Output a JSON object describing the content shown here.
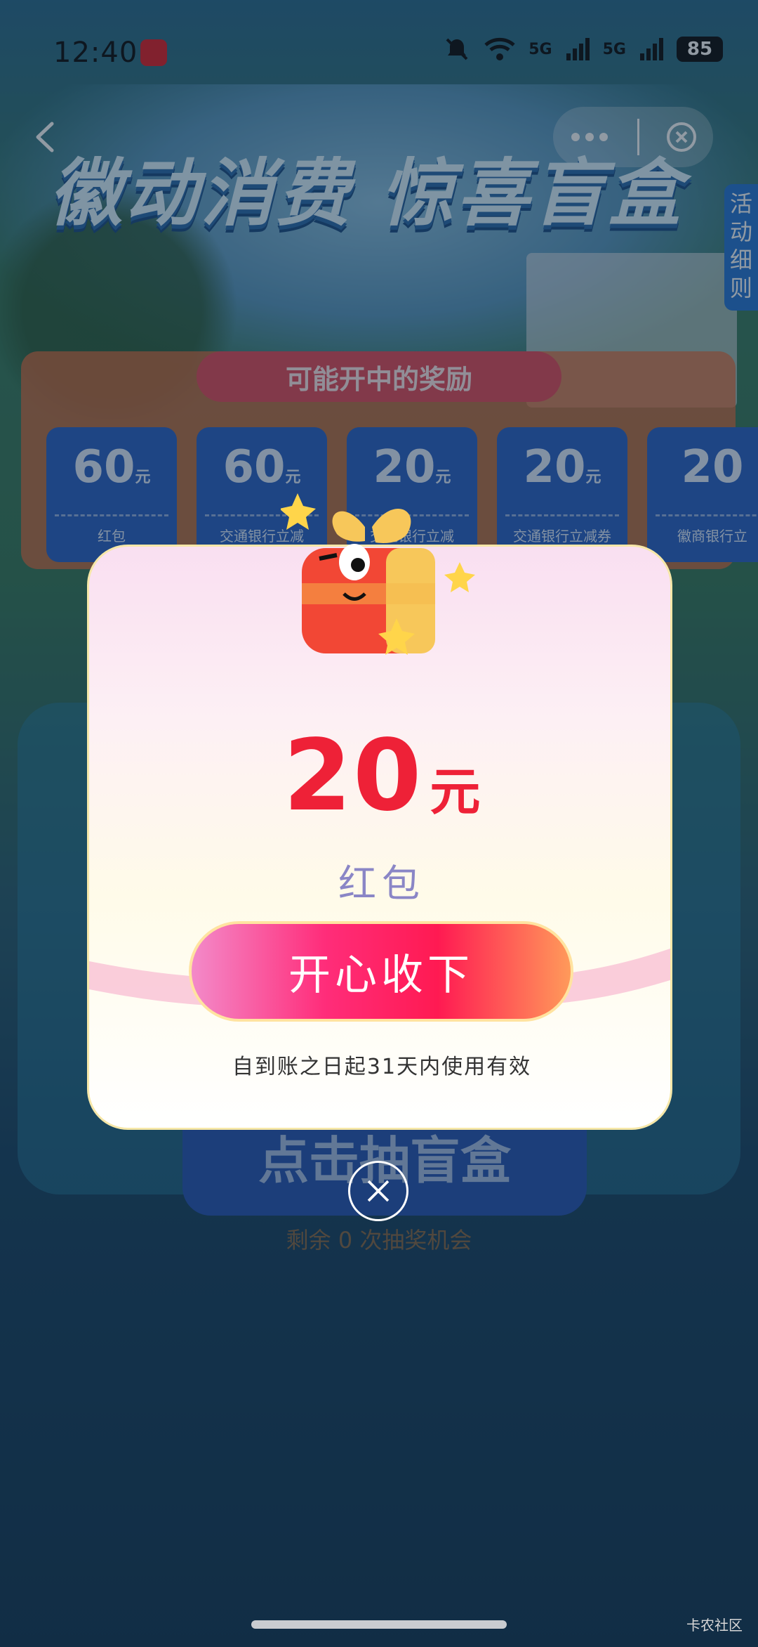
{
  "status_bar": {
    "time": "12:40",
    "battery": "85",
    "network_1": "5G",
    "network_2": "5G",
    "icons": [
      "app-badge-icon",
      "mute-bell-icon",
      "wifi-icon",
      "signal-icon",
      "signal-icon",
      "battery-icon"
    ]
  },
  "nav": {
    "back_icon": "back-arrow-icon",
    "more_icon": "more-dots-icon",
    "close_icon": "close-circle-icon"
  },
  "banner": {
    "title": "徽动消费 惊喜盲盒",
    "side_tab": "活动细则"
  },
  "rewards": {
    "title": "可能开中的奖励",
    "items": [
      {
        "value": "60",
        "unit": "元",
        "name": "红包"
      },
      {
        "value": "60",
        "unit": "元",
        "name": "交通银行立减"
      },
      {
        "value": "20",
        "unit": "元",
        "name": "交通银行立减"
      },
      {
        "value": "20",
        "unit": "元",
        "name": "交通银行立减券"
      },
      {
        "value": "20",
        "unit": "",
        "name": "徽商银行立"
      }
    ]
  },
  "draw": {
    "button_label": "点击抽盲盒",
    "remaining_text": "剩余 0 次抽奖机会"
  },
  "modal": {
    "amount": "20",
    "unit": "元",
    "reward_type": "红包",
    "accept_label": "开心收下",
    "validity": "自到账之日起31天内使用有效",
    "close_icon": "close-icon",
    "accent_color": "#ee2137"
  },
  "watermark": "卡农社区"
}
